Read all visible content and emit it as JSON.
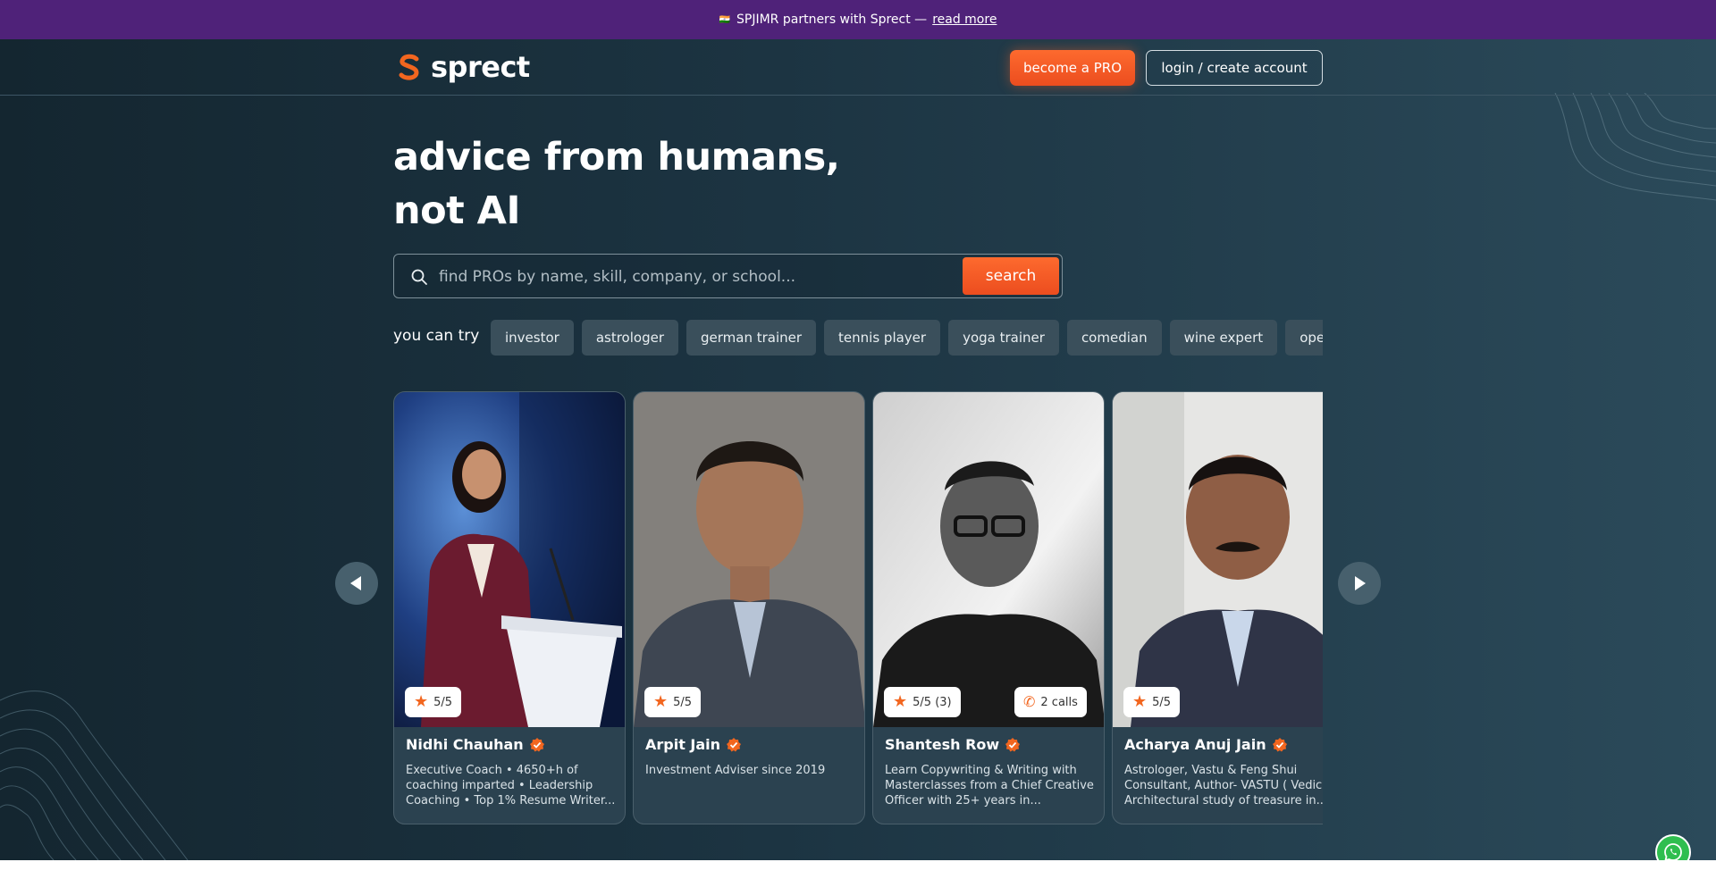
{
  "banner": {
    "flag": "🇮🇳",
    "text": "SPJIMR partners with Sprect —",
    "link": "read more"
  },
  "header": {
    "logo_text": "sprect",
    "pro_button": "become a PRO",
    "login_button": "login / create account"
  },
  "hero": {
    "headline_line1": "advice from humans,",
    "headline_line2": "not AI"
  },
  "search": {
    "placeholder": "find PROs by name, skill, company, or school...",
    "button": "search"
  },
  "try": {
    "label": "you can try",
    "chips": [
      "investor",
      "astrologer",
      "german trainer",
      "tennis player",
      "yoga trainer",
      "comedian",
      "wine expert",
      "operations"
    ]
  },
  "cards": [
    {
      "name": "Nidhi Chauhan",
      "rating": "5/5",
      "calls": "",
      "desc": "Executive Coach • 4650+h of coaching imparted • Leadership Coaching • Top 1% Resume Writer..."
    },
    {
      "name": "Arpit Jain",
      "rating": "5/5",
      "calls": "",
      "desc": "Investment Adviser since 2019"
    },
    {
      "name": "Shantesh Row",
      "rating": "5/5 (3)",
      "calls": "2 calls",
      "desc": "Learn Copywriting & Writing with Masterclasses from a Chief Creative Officer with 25+ years in..."
    },
    {
      "name": "Acharya Anuj Jain",
      "rating": "5/5",
      "calls": "",
      "desc": "Astrologer, Vastu & Feng Shui Consultant, Author- VASTU ( Vedic Architectural study of treasure in..."
    }
  ],
  "colors": {
    "banner": "#4f2279",
    "accent": "#f2661f",
    "background": "#1c3442",
    "whatsapp": "#2fbe4f"
  },
  "icons": {
    "prev": "triangle-left-icon",
    "next": "triangle-right-icon",
    "search": "search-icon",
    "rating": "star-icon",
    "calls": "phone-icon",
    "verified": "verified-badge-icon",
    "chat": "whatsapp-icon"
  }
}
